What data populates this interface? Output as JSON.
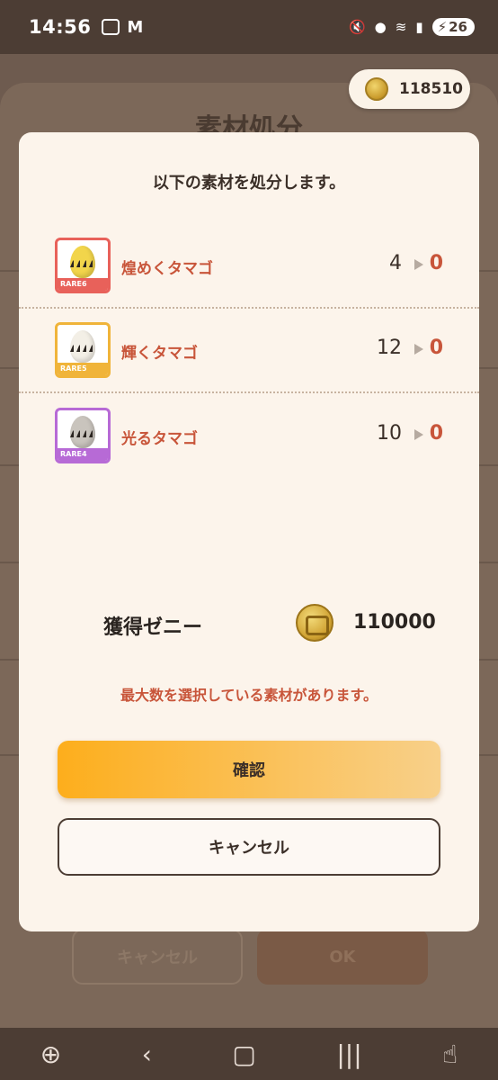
{
  "status_bar": {
    "time": "14:56",
    "mail_icon_label": "M",
    "battery": "26"
  },
  "background": {
    "title": "素材処分",
    "cancel_label": "キャンセル",
    "ok_label": "OK"
  },
  "zeny_chip": {
    "amount": "118510"
  },
  "modal": {
    "message": "以下の素材を処分します。",
    "items": [
      {
        "name": "煌めくタマゴ",
        "rarity": "RARE6",
        "count": "4",
        "result": "0",
        "frame_color": "#e8615a",
        "egg_color": "#f2d54b"
      },
      {
        "name": "輝くタマゴ",
        "rarity": "RARE5",
        "count": "12",
        "result": "0",
        "frame_color": "#f0b43a",
        "egg_color": "#f3efe6"
      },
      {
        "name": "光るタマゴ",
        "rarity": "RARE4",
        "count": "10",
        "result": "0",
        "frame_color": "#b76ad6",
        "egg_color": "#c9c4bd"
      }
    ],
    "gain_label": "獲得ゼニー",
    "gain_amount": "110000",
    "warning": "最大数を選択している素材があります。",
    "confirm_label": "確認",
    "cancel_label": "キャンセル"
  },
  "nav_bar": {
    "back_icon": "chevron-left-icon",
    "home_icon": "home-icon",
    "recents_icon": "recents-icon"
  }
}
